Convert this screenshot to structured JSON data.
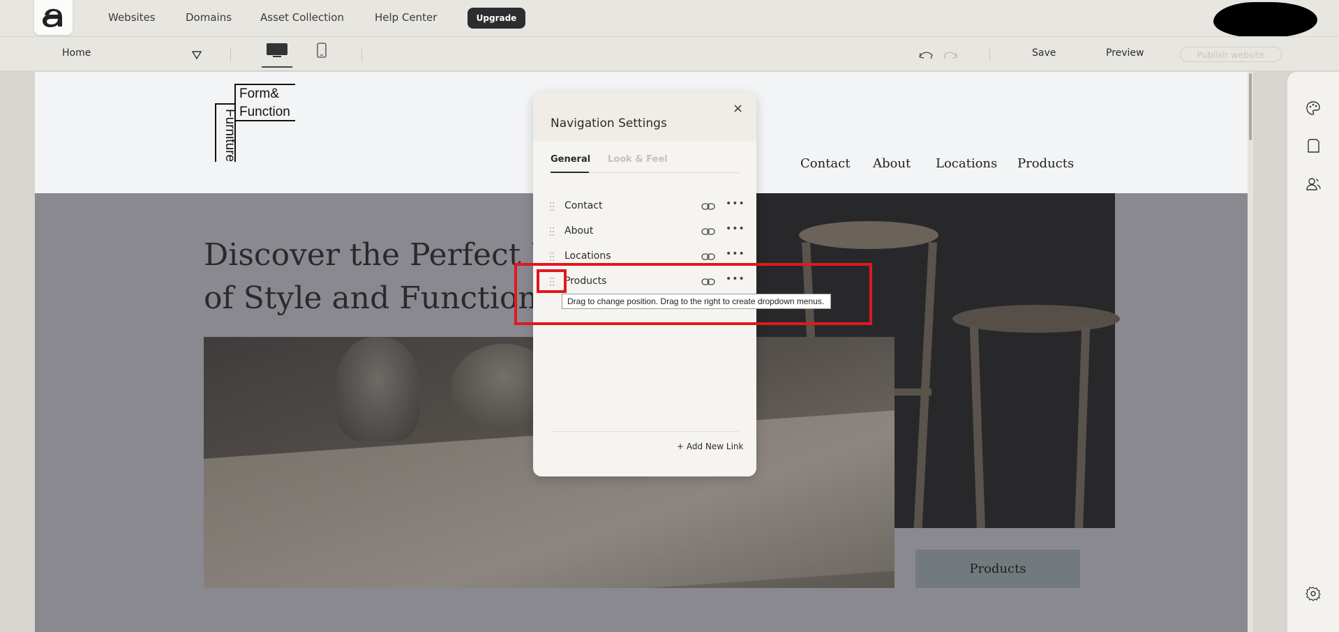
{
  "topbar": {
    "nav": [
      "Websites",
      "Domains",
      "Asset Collection",
      "Help Center"
    ],
    "upgrade_label": "Upgrade"
  },
  "toolbar": {
    "page": "Home",
    "save_label": "Save",
    "preview_label": "Preview",
    "publish_label": "Publish website"
  },
  "site": {
    "brand_top": "Form&",
    "brand_mid": "Function",
    "brand_vertical": "Furniture",
    "nav": [
      "Contact",
      "About",
      "Locations",
      "Products"
    ],
    "headline_1": "Discover the Perfect F",
    "headline_2": "of Style and Functiona",
    "cta": "Products"
  },
  "panel": {
    "title": "Navigation Settings",
    "tabs": [
      "General",
      "Look & Feel"
    ],
    "active_tab": "General",
    "items": [
      "Contact",
      "About",
      "Locations",
      "Products"
    ],
    "add_link": "+ Add New Link",
    "tooltip": "Drag to change position. Drag to the right to create dropdown menus."
  },
  "icons": {
    "rail": [
      "palette-icon",
      "page-icon",
      "users-icon",
      "settings-icon"
    ],
    "highlight_color": "#e0181e"
  }
}
